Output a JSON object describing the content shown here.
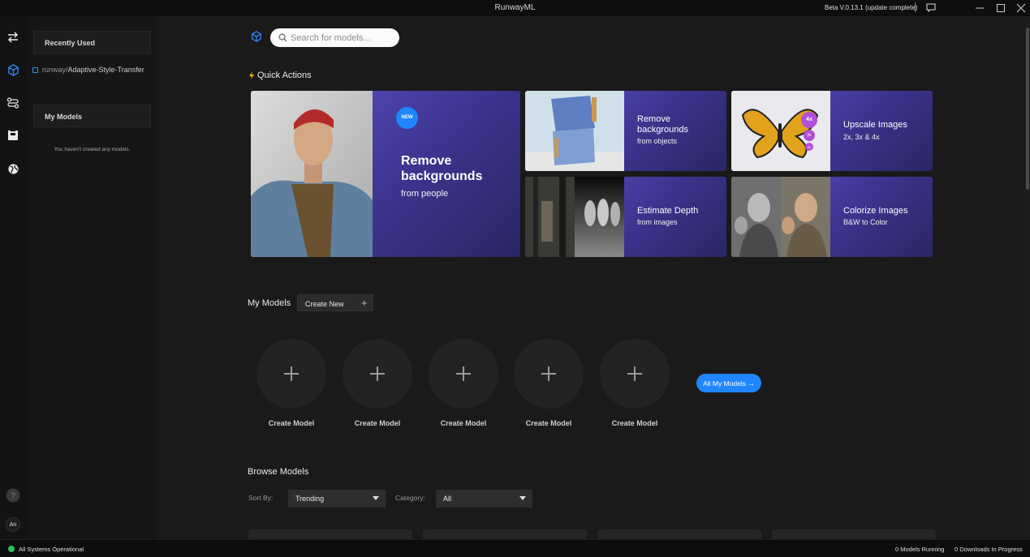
{
  "app": {
    "title": "RunwayML",
    "version": "Beta V.0.13.1 (update complete)",
    "accent_color": "#1f86ff"
  },
  "rail": {
    "icons": [
      "swap-arrows-icon",
      "model-cube-icon",
      "workflow-icon",
      "inbox-icon",
      "globe-icon"
    ],
    "help_icon": "question-icon",
    "avatar_initials": "An"
  },
  "sidebar": {
    "recently_used_label": "Recently Used",
    "recent_items": [
      {
        "owner": "runway/",
        "name": "Adaptive-Style-Transfer"
      }
    ],
    "my_models_label": "My Models",
    "empty_message": "You haven't created any models."
  },
  "search": {
    "placeholder": "Search for models..."
  },
  "quick_actions": {
    "title": "Quick Actions",
    "featured": {
      "badge": "NEW",
      "title_line1": "Remove",
      "title_line2": "backgrounds",
      "subtitle": "from people"
    },
    "cards": [
      {
        "title_line1": "Remove",
        "title_line2": "backgrounds",
        "subtitle": "from objects"
      },
      {
        "title_line1": "Upscale Images",
        "title_line2": "",
        "subtitle": "2x, 3x & 4x",
        "chips": [
          "4x",
          "3x",
          "2x"
        ]
      },
      {
        "title_line1": "Estimate Depth",
        "title_line2": "",
        "subtitle": "from images"
      },
      {
        "title_line1": "Colorize Images",
        "title_line2": "",
        "subtitle": "B&W to Color"
      }
    ]
  },
  "my_models": {
    "title": "My Models",
    "create_new_label": "Create New",
    "slots": [
      "Create Model",
      "Create Model",
      "Create Model",
      "Create Model",
      "Create Model"
    ],
    "all_models_label": "All My Models →"
  },
  "browse": {
    "title": "Browse Models",
    "sort_label": "Sort By:",
    "sort_value": "Trending",
    "category_label": "Category:",
    "category_value": "All"
  },
  "status": {
    "system": "All Systems Operational",
    "system_color": "#28c35a",
    "models_running": "0 Models Running",
    "downloads": "0 Downloads In Progress"
  }
}
